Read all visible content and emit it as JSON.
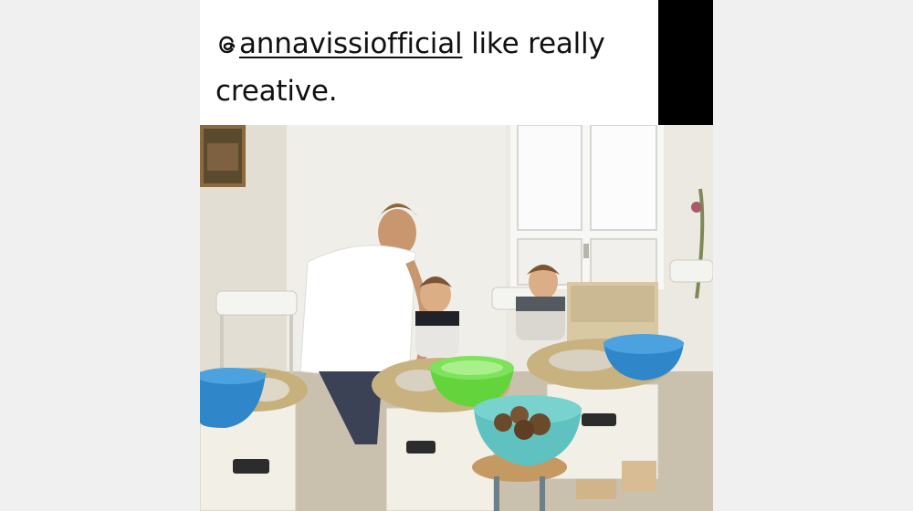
{
  "post": {
    "caption": {
      "mention_icon": "threads-at-icon",
      "mention": "annavissiofficial",
      "text_line1": " like really",
      "text_line2": "creative."
    },
    "photo": {
      "alt": "photo"
    }
  },
  "colors": {
    "page_bg": "#f0f0f0",
    "panel_bg": "#ffffff",
    "side_bar": "#000000",
    "caption_text": "#111111"
  }
}
